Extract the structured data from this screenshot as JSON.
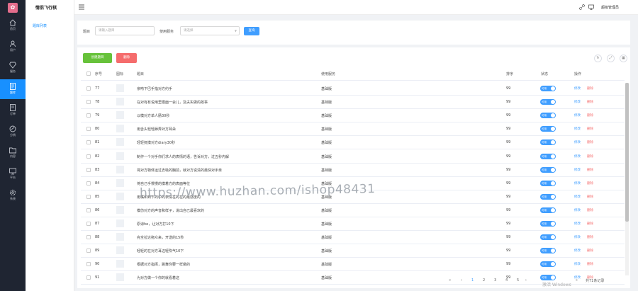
{
  "app": {
    "logo_glyph": "✿",
    "name": "情侣飞行棋",
    "brand_color": "#1890ff"
  },
  "nav": [
    {
      "label": "首页",
      "icon": "home-icon"
    },
    {
      "label": "用户",
      "icon": "user-icon"
    },
    {
      "label": "服务",
      "icon": "diamond-icon"
    },
    {
      "label": "题库",
      "icon": "document-icon",
      "active": true
    },
    {
      "label": "订单",
      "icon": "order-icon"
    },
    {
      "label": "分销",
      "icon": "share-icon"
    },
    {
      "label": "内容",
      "icon": "folder-icon"
    },
    {
      "label": "平台",
      "icon": "monitor-icon"
    },
    {
      "label": "系统",
      "icon": "gear-icon"
    }
  ],
  "submenu": {
    "item": "题库列表"
  },
  "header": {
    "admin": "超级管理员"
  },
  "filter": {
    "question_label": "题目",
    "question_placeholder": "请输入题目",
    "service_label": "使用服务",
    "service_placeholder": "请选择",
    "search_button": "查询"
  },
  "toolbar": {
    "create": "创建题目",
    "delete": "删除"
  },
  "table": {
    "headers": {
      "index": "序号",
      "image": "图标",
      "title": "题目",
      "service": "使用服务",
      "sort": "排序",
      "status": "状态",
      "actions": "操作"
    },
    "rows": [
      {
        "id": "77",
        "title": "亲吻下巴手指对方约手",
        "service": "基础版",
        "sort": "99"
      },
      {
        "id": "78",
        "title": "在对有有说用里模面一会儿，及夫实做的故事",
        "service": "基础版",
        "sort": "99"
      },
      {
        "id": "79",
        "title": "以模对方单人肠30秒",
        "service": "基础版",
        "sort": "99"
      },
      {
        "id": "80",
        "title": "用舌头轻轻舔弄对方耳朵",
        "service": "基础版",
        "sort": "99"
      },
      {
        "id": "81",
        "title": "轻轻抚摸对方diary30秒",
        "service": "基础版",
        "sort": "99"
      },
      {
        "id": "82",
        "title": "制作一个对手你们求人的表情的语，告诉对方，过五秒内解",
        "service": "基础版",
        "sort": "99"
      },
      {
        "id": "83",
        "title": "将对方物体运过去吸的胸前，就对方说清的最快对手亲",
        "service": "基础版",
        "sort": "99"
      },
      {
        "id": "84",
        "title": "将自己手慢慢的摸着方的表面等位",
        "service": "基础版",
        "sort": "99"
      },
      {
        "id": "85",
        "title": "用嘴和到下的中的表情在的在的最感度的",
        "service": "基础版",
        "sort": "99"
      },
      {
        "id": "86",
        "title": "模仿对方的声音和样子，说出自己最喜欢的",
        "service": "基础版",
        "sort": "99"
      },
      {
        "id": "87",
        "title": "原谅he，让对方打10下",
        "service": "基础版",
        "sort": "99"
      },
      {
        "id": "88",
        "title": "完全拉达拖众来，开送的15秒",
        "service": "基础版",
        "sort": "99"
      },
      {
        "id": "89",
        "title": "轻轻的在对方耳边轻吹气10下",
        "service": "基础版",
        "sort": "99"
      },
      {
        "id": "90",
        "title": "根据对方指挥，跳舞你要一样做的",
        "service": "基础版",
        "sort": "99"
      },
      {
        "id": "91",
        "title": "为对方做一个你的就看着这",
        "service": "基础版",
        "sort": "99"
      }
    ],
    "status_text": "可用",
    "edit": "修改",
    "remove": "删除"
  },
  "pagination": {
    "pages": [
      "1",
      "2",
      "3",
      "4",
      "5"
    ],
    "current": "1",
    "total": "共71条记录"
  },
  "watermark": "https://www.huzhan.com/ishop48431",
  "win_activation": "激活 Windows"
}
